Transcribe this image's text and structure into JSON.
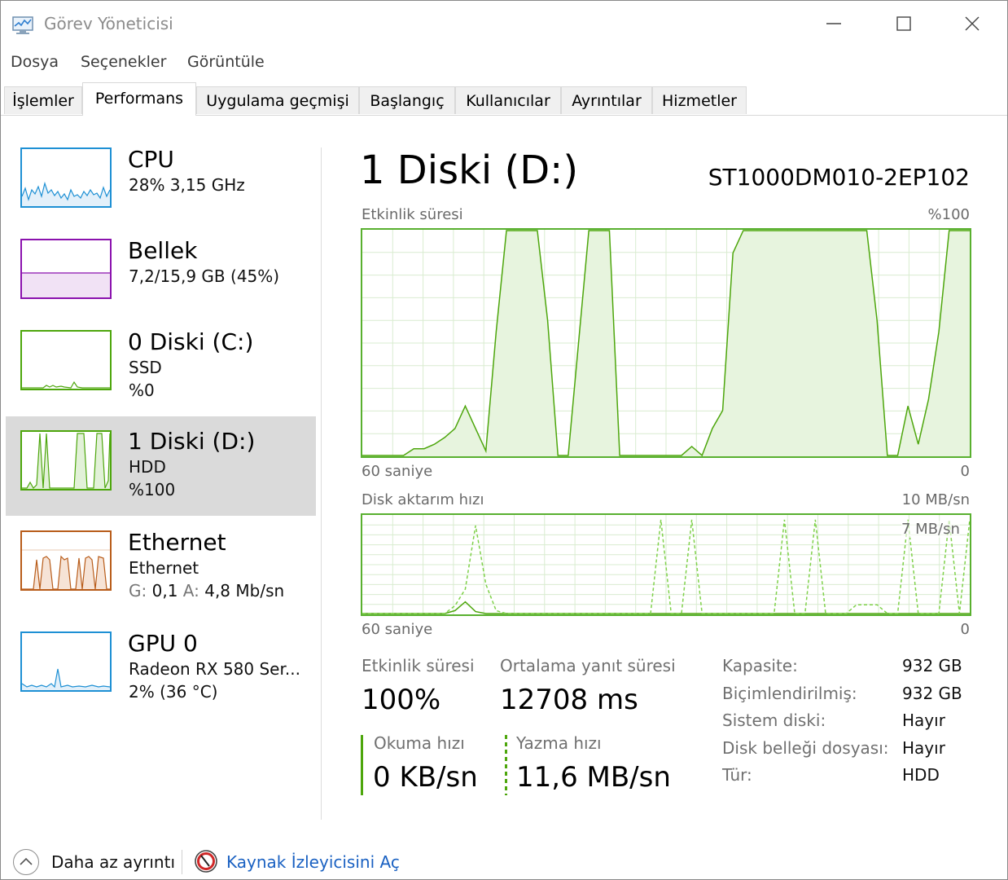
{
  "window": {
    "title": "Görev Yöneticisi"
  },
  "menu": [
    "Dosya",
    "Seçenekler",
    "Görüntüle"
  ],
  "tabs": [
    {
      "label": "İşlemler",
      "active": false
    },
    {
      "label": "Performans",
      "active": true
    },
    {
      "label": "Uygulama geçmişi",
      "active": false
    },
    {
      "label": "Başlangıç",
      "active": false
    },
    {
      "label": "Kullanıcılar",
      "active": false
    },
    {
      "label": "Ayrıntılar",
      "active": false
    },
    {
      "label": "Hizmetler",
      "active": false
    }
  ],
  "sidebar": {
    "items": [
      {
        "title": "CPU",
        "line1": "28% 3,15 GHz",
        "line2": "",
        "color": "#1e90d4",
        "selected": false
      },
      {
        "title": "Bellek",
        "line1": "7,2/15,9 GB (45%)",
        "line2": "",
        "color": "#8b12ae",
        "selected": false
      },
      {
        "title": "0 Diski (C:)",
        "line1": "SSD",
        "line2": "%0",
        "color": "#4da60c",
        "selected": false
      },
      {
        "title": "1 Diski (D:)",
        "line1": "HDD",
        "line2": "%100",
        "color": "#4da60c",
        "selected": true
      },
      {
        "title": "Ethernet",
        "line1": "Ethernet",
        "line2_g_label": "G:",
        "line2_g_value": "0,1",
        "line2_a_label": "A:",
        "line2_a_value": "4,8 Mb/sn",
        "color": "#b85c1a",
        "selected": false
      },
      {
        "title": "GPU 0",
        "line1": "Radeon RX 580 Ser...",
        "line2": "2% (36 °C)",
        "color": "#1e90d4",
        "selected": false
      }
    ]
  },
  "main": {
    "title": "1 Diski (D:)",
    "model": "ST1000DM010-2EP102",
    "activity_chart": {
      "label": "Etkinlik süresi",
      "max_label": "%100",
      "time_left": "60 saniye",
      "time_right": "0"
    },
    "transfer_chart": {
      "label": "Disk aktarım hızı",
      "max_label": "10 MB/sn",
      "inner_label": "7 MB/sn",
      "time_left": "60 saniye",
      "time_right": "0"
    },
    "stats": {
      "active_time_label": "Etkinlik süresi",
      "active_time_value": "100%",
      "avg_response_label": "Ortalama yanıt süresi",
      "avg_response_value": "12708 ms",
      "read_label": "Okuma hızı",
      "read_value": "0 KB/sn",
      "write_label": "Yazma hızı",
      "write_value": "11,6 MB/sn"
    },
    "properties": [
      {
        "label": "Kapasite:",
        "value": "932 GB"
      },
      {
        "label": "Biçimlendirilmiş:",
        "value": "932 GB"
      },
      {
        "label": "Sistem diski:",
        "value": "Hayır"
      },
      {
        "label": "Disk belleği dosyası:",
        "value": "Hayır"
      },
      {
        "label": "Tür:",
        "value": "HDD"
      }
    ]
  },
  "footer": {
    "less_details": "Daha az ayrıntı",
    "resource_monitor": "Kaynak İzleyicisini Aç"
  },
  "chart_data": [
    {
      "type": "area",
      "title": "Etkinlik süresi",
      "xlabel": "60 saniye",
      "ylabel": "%100",
      "xlim": [
        60,
        0
      ],
      "ylim": [
        0,
        100
      ],
      "series": [
        {
          "values": [
            0,
            0,
            0,
            0,
            0,
            3,
            3,
            5,
            8,
            12,
            22,
            12,
            2,
            55,
            100,
            100,
            100,
            100,
            60,
            0,
            0,
            50,
            100,
            100,
            100,
            0,
            0,
            0,
            0,
            0,
            0,
            0,
            4,
            0,
            12,
            20,
            90,
            100,
            100,
            100,
            100,
            100,
            100,
            100,
            100,
            100,
            100,
            100,
            100,
            100,
            60,
            0,
            0,
            22,
            5,
            25,
            55,
            100,
            100,
            100
          ]
        }
      ]
    },
    {
      "type": "line",
      "title": "Disk aktarım hızı",
      "xlabel": "60 saniye",
      "ylabel": "10 MB/sn",
      "xlim": [
        60,
        0
      ],
      "ylim": [
        0,
        10
      ],
      "series": [
        {
          "name": "Okuma hızı",
          "values": [
            0,
            0,
            0,
            0,
            0,
            0,
            0,
            0,
            0,
            0.3,
            1.2,
            0.2,
            0,
            0,
            0,
            0,
            0,
            0,
            0,
            0,
            0,
            0,
            0,
            0,
            0,
            0,
            0,
            0,
            0,
            0,
            0,
            0,
            0,
            0,
            0,
            0,
            0,
            0,
            0,
            0,
            0,
            0,
            0,
            0,
            0,
            0,
            0,
            0,
            0,
            0,
            0,
            0,
            0,
            0,
            0,
            0,
            0,
            0,
            0,
            0
          ]
        },
        {
          "name": "Yazma hızı",
          "values": [
            0,
            0,
            0,
            0,
            0,
            0,
            0,
            0,
            0,
            0.8,
            2.5,
            9.0,
            3.0,
            0.3,
            0,
            0,
            0,
            0,
            0,
            0,
            0,
            0,
            0,
            0,
            0,
            0,
            0,
            0,
            0,
            9.6,
            0,
            0,
            9.6,
            0,
            0,
            0,
            0,
            0,
            0,
            0,
            0,
            9.6,
            0,
            0,
            9.6,
            0,
            0,
            0,
            0.9,
            0.9,
            0.9,
            0,
            0,
            9.6,
            0,
            0,
            0,
            9.6,
            0,
            9.6
          ]
        }
      ]
    }
  ]
}
